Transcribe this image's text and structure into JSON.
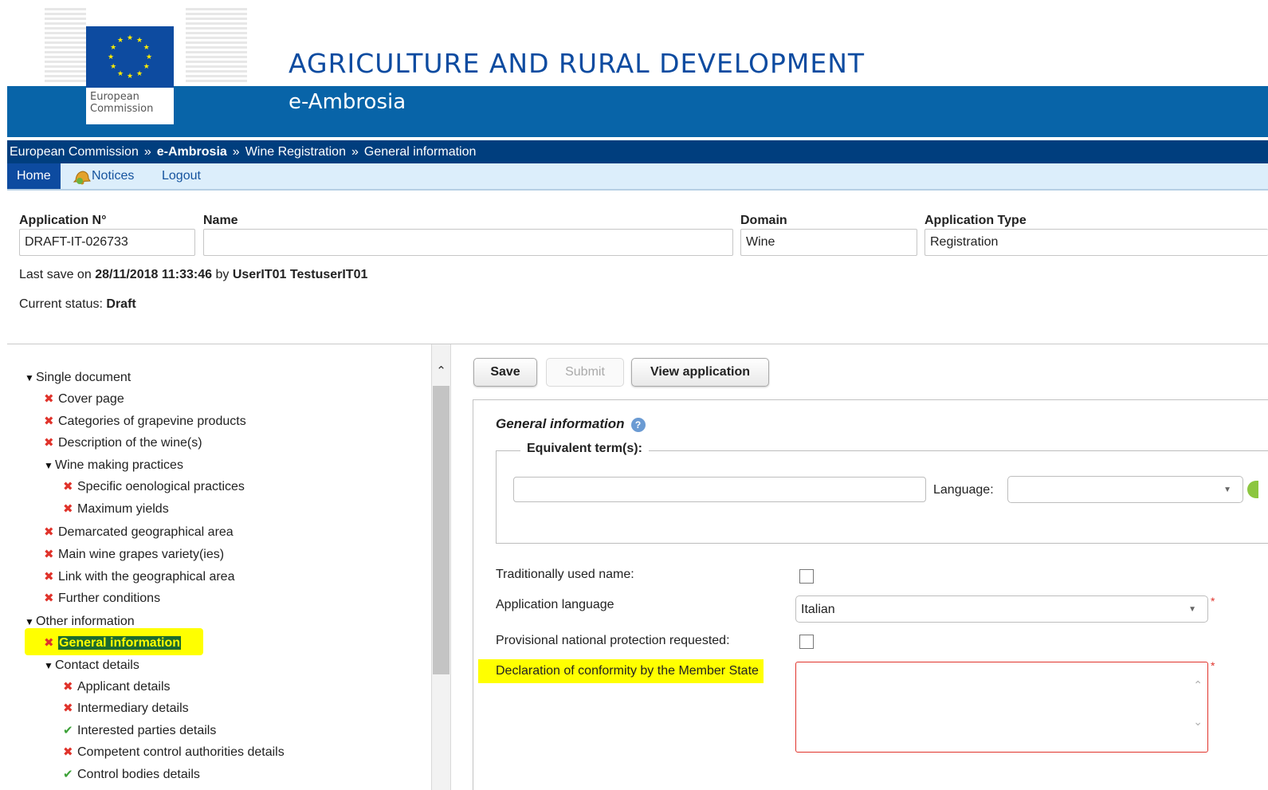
{
  "header": {
    "logo_text": "European Commission",
    "title": "AGRICULTURE AND RURAL DEVELOPMENT",
    "subtitle": "e-Ambrosia"
  },
  "breadcrumb": {
    "items": [
      "European Commission",
      "e-Ambrosia",
      "Wine Registration",
      "General information"
    ],
    "separator": "»"
  },
  "menu": {
    "home": "Home",
    "notices": "Notices",
    "logout": "Logout"
  },
  "application": {
    "number_label": "Application N°",
    "number_value": "DRAFT-IT-026733",
    "name_label": "Name",
    "name_value": "",
    "domain_label": "Domain",
    "domain_value": "Wine",
    "type_label": "Application Type",
    "type_value": "Registration",
    "last_save_prefix": "Last save on",
    "last_save_datetime": "28/11/2018 11:33:46",
    "last_save_by": "by",
    "last_save_user": "UserIT01 TestuserIT01",
    "status_prefix": "Current status:",
    "status_value": "Draft"
  },
  "tree": {
    "items": [
      {
        "label": "Single document",
        "type": "folder",
        "level": 0
      },
      {
        "label": "Cover page",
        "type": "error",
        "level": 1
      },
      {
        "label": "Categories of grapevine products",
        "type": "error",
        "level": 1
      },
      {
        "label": "Description of the wine(s)",
        "type": "error",
        "level": 1
      },
      {
        "label": "Wine making practices",
        "type": "folder",
        "level": 1
      },
      {
        "label": "Specific oenological practices",
        "type": "error",
        "level": 2
      },
      {
        "label": "Maximum yields",
        "type": "error",
        "level": 2
      },
      {
        "label": "Demarcated geographical area",
        "type": "error",
        "level": 1
      },
      {
        "label": "Main wine grapes variety(ies)",
        "type": "error",
        "level": 1
      },
      {
        "label": "Link with the geographical area",
        "type": "error",
        "level": 1
      },
      {
        "label": "Further conditions",
        "type": "error",
        "level": 1
      },
      {
        "label": "Other information",
        "type": "folder",
        "level": 0
      },
      {
        "label": "General information",
        "type": "error",
        "level": 1,
        "active": true
      },
      {
        "label": "Contact details",
        "type": "folder",
        "level": 1
      },
      {
        "label": "Applicant details",
        "type": "error",
        "level": 2
      },
      {
        "label": "Intermediary details",
        "type": "error",
        "level": 2
      },
      {
        "label": "Interested parties details",
        "type": "ok",
        "level": 2
      },
      {
        "label": "Competent control authorities details",
        "type": "error",
        "level": 2
      },
      {
        "label": "Control bodies details",
        "type": "ok",
        "level": 2
      }
    ]
  },
  "toolbar": {
    "save": "Save",
    "submit": "Submit",
    "view": "View application"
  },
  "form": {
    "section_title": "General information",
    "equivalent_terms_legend": "Equivalent term(s):",
    "equivalent_term_value": "",
    "language_label": "Language:",
    "language_value": "",
    "traditional_name_label": "Traditionally used name:",
    "traditional_name_checked": false,
    "application_language_label": "Application language",
    "application_language_value": "Italian",
    "provisional_protection_label": "Provisional national protection requested:",
    "provisional_protection_checked": false,
    "declaration_label": "Declaration of conformity by the Member State",
    "declaration_value": "",
    "required_mark": "*"
  },
  "colors": {
    "header_blue": "#0864a8",
    "breadcrumb_blue": "#003e7e",
    "menu_bg": "#dceefb",
    "error_red": "#e0332b",
    "ok_green": "#3ca137",
    "highlight_yellow": "#ffff00"
  }
}
